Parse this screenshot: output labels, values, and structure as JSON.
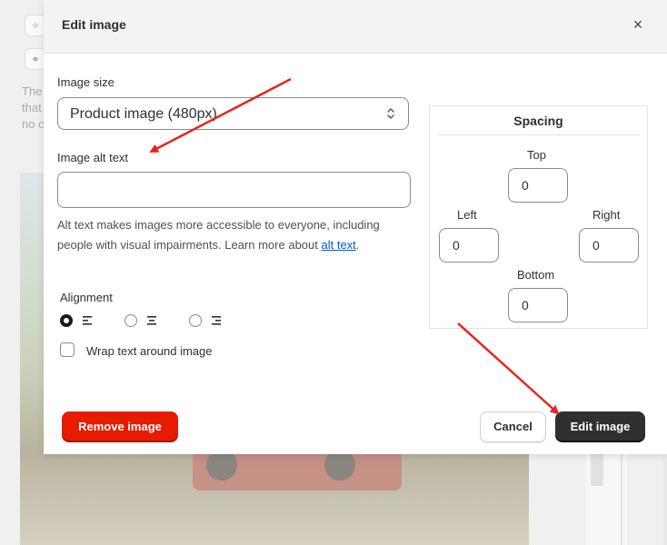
{
  "background": {
    "text_lines": [
      "The",
      "that",
      "no c"
    ]
  },
  "modal": {
    "title": "Edit image",
    "close_glyph": "×",
    "image_size": {
      "label": "Image size",
      "selected": "Product image (480px)"
    },
    "alt_text": {
      "label": "Image alt text",
      "value": "",
      "help_before": "Alt text makes images more accessible to everyone, including people with visual impairments. Learn more about ",
      "help_link": "alt text",
      "help_after": "."
    },
    "alignment": {
      "label": "Alignment",
      "options": [
        "align-left",
        "align-center",
        "align-right"
      ],
      "selected": "align-left"
    },
    "wrap_text": {
      "label": "Wrap text around image",
      "checked": false
    },
    "spacing": {
      "title": "Spacing",
      "top_label": "Top",
      "top_value": "0",
      "left_label": "Left",
      "left_value": "0",
      "right_label": "Right",
      "right_value": "0",
      "bottom_label": "Bottom",
      "bottom_value": "0"
    },
    "buttons": {
      "remove": "Remove image",
      "cancel": "Cancel",
      "confirm": "Edit image"
    }
  },
  "colors": {
    "annotation_arrow": "#e8241c",
    "destructive": "#e51c00",
    "primary": "#303030",
    "link": "#005bd3"
  }
}
